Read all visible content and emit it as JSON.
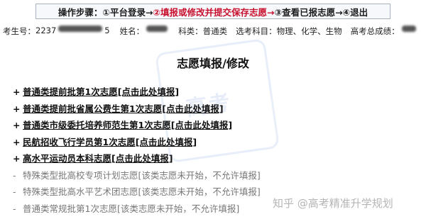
{
  "steps": {
    "label": "操作步骤：",
    "items": [
      {
        "text": "①平台登录→",
        "active": false
      },
      {
        "text": "②填报或修改并提交保存志愿→",
        "active": true
      },
      {
        "text": "③查看已报志愿→",
        "active": false
      },
      {
        "text": "④退出",
        "active": false
      }
    ]
  },
  "student_info": {
    "id_label": "考生号：",
    "id_visible_prefix": "2237",
    "id_visible_suffix": "5",
    "name_label": "姓名：",
    "category_label": "科类：",
    "category_value": "普通类",
    "subjects_label": "选考科目：",
    "subjects_value": "物理、化学、生物",
    "score_label": "高考总成绩："
  },
  "page_title": "志愿填报/修改",
  "watermark_text": "高考",
  "options": [
    {
      "mark": "+",
      "text": "普通类提前批第1次志愿[点击此处填报]",
      "enabled": true
    },
    {
      "mark": "+",
      "text": "普通类提前批省属公费生第1次志愿[点击此处填报]",
      "enabled": true
    },
    {
      "mark": "+",
      "text": "普通类市级委托培养师范生第1次志愿[点击此处填报]",
      "enabled": true
    },
    {
      "mark": "+",
      "text": "民航招收飞行学员第1次志愿[点击此处填报]",
      "enabled": true
    },
    {
      "mark": "+",
      "text": "高水平运动员本科志愿[点击此处填报]",
      "enabled": true
    },
    {
      "mark": "-",
      "text": "特殊类型批高校专项计划志愿[该类志愿未开始，不允许填报]",
      "enabled": false
    },
    {
      "mark": "-",
      "text": "特殊类型批高水平艺术团志愿[该类志愿未开始，不允许填报]",
      "enabled": false
    },
    {
      "mark": "-",
      "text": "普通类常规批第1次志愿[该类志愿未开始，不允许填报]",
      "enabled": false
    }
  ],
  "footer_watermark": "知乎 @高考精准升学规划",
  "colors": {
    "active_step": "#c8102e",
    "disabled_text": "#777777"
  }
}
